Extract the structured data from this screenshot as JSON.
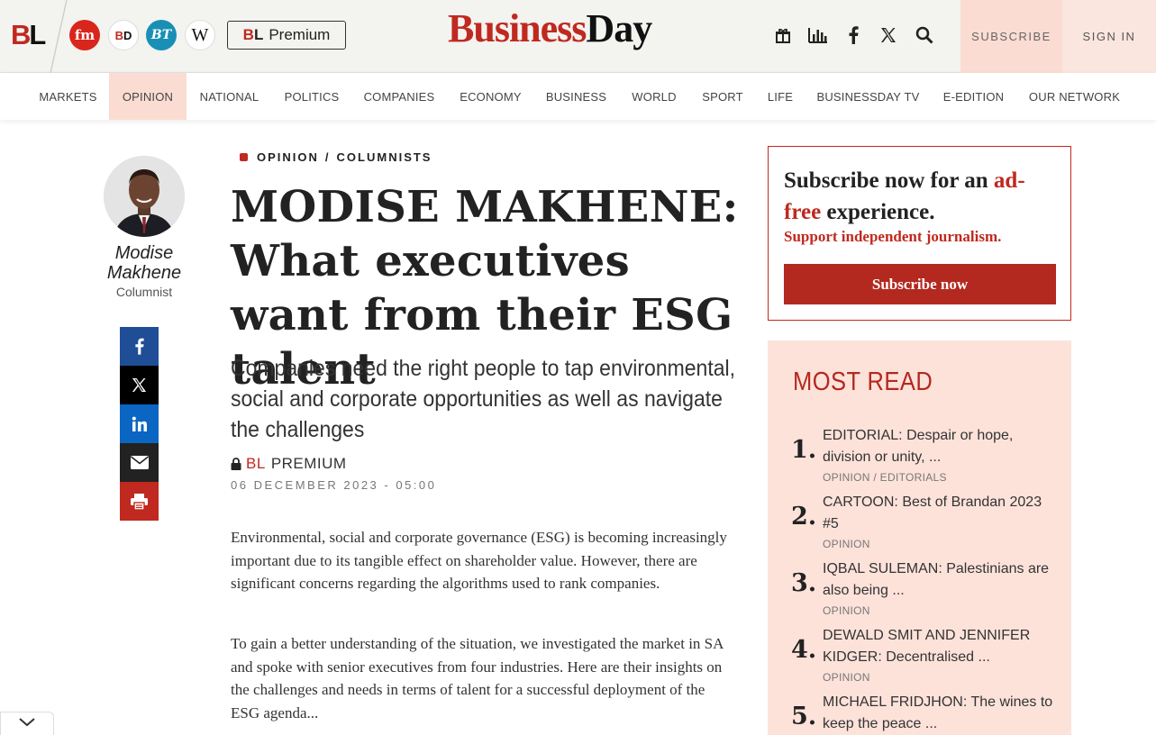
{
  "header": {
    "bl_logo_b": "B",
    "bl_logo_l": "L",
    "brands": {
      "fm": "fm",
      "bd_b": "B",
      "bd_d": "D",
      "bt": "BT",
      "w": "W"
    },
    "premium_b": "B",
    "premium_l": "L",
    "premium_label": "Premium",
    "site_logo_business": "Business",
    "site_logo_day": "Day",
    "icons": [
      "gift-icon",
      "chart-icon",
      "facebook-icon",
      "x-icon",
      "search-icon"
    ],
    "subscribe_label": "SUBSCRIBE",
    "signin_label": "SIGN IN"
  },
  "nav": {
    "items": [
      {
        "label": "MARKETS"
      },
      {
        "label": "OPINION",
        "active": true
      },
      {
        "label": "NATIONAL"
      },
      {
        "label": "POLITICS"
      },
      {
        "label": "COMPANIES"
      },
      {
        "label": "ECONOMY"
      },
      {
        "label": "BUSINESS"
      },
      {
        "label": "WORLD"
      },
      {
        "label": "SPORT"
      },
      {
        "label": "LIFE"
      },
      {
        "label": "BUSINESSDAY TV"
      },
      {
        "label": "E-EDITION"
      },
      {
        "label": "OUR NETWORK"
      }
    ]
  },
  "author": {
    "name_line1": "Modise",
    "name_line2": "Makhene",
    "role": "Columnist"
  },
  "share": {
    "buttons": [
      {
        "name": "facebook-icon",
        "color": "#1f4e96"
      },
      {
        "name": "x-icon",
        "color": "#000000"
      },
      {
        "name": "linkedin-icon",
        "color": "#0a66c2"
      },
      {
        "name": "mail-icon",
        "color": "#222222"
      },
      {
        "name": "print-icon",
        "color": "#c0291f"
      }
    ]
  },
  "article": {
    "section": "OPINION",
    "separator": "/",
    "subsection": "COLUMNISTS",
    "headline": "MODISE MAKHENE: What executives want from their ESG talent",
    "standfirst": "Companies need the right people to tap environmental, social and corporate opportunities as well as navigate the challenges",
    "premium_b": "B",
    "premium_l": "L",
    "premium_label": "PREMIUM",
    "date": "06 DECEMBER 2023 - 05:00",
    "paragraphs": [
      "Environmental, social and corporate governance (ESG) is becoming increasingly important due to its tangible effect on shareholder value. However, there are significant concerns regarding the algorithms used to rank companies.",
      "To gain a better understanding of the situation, we investigated the market in SA and spoke with senior executives from four industries. Here are their insights on the challenges and needs in terms of talent for a successful deployment of the ESG agenda..."
    ]
  },
  "subscribe_box": {
    "title_pre": "Subscribe now for an ",
    "title_red": "ad-free",
    "title_post": " experience.",
    "line": "Support independent journalism.",
    "button": "Subscribe now"
  },
  "most_read": {
    "title": "MOST READ",
    "items": [
      {
        "num": "1.",
        "title": "EDITORIAL: Despair or hope, division or unity, ...",
        "cat": "OPINION / EDITORIALS"
      },
      {
        "num": "2.",
        "title": "CARTOON: Best of Brandan 2023 #5",
        "cat": "OPINION"
      },
      {
        "num": "3.",
        "title": "IQBAL SULEMAN: Palestinians are also being ...",
        "cat": "OPINION"
      },
      {
        "num": "4.",
        "title": "DEWALD SMIT AND JENNIFER KIDGER: Decentralised ...",
        "cat": "OPINION"
      },
      {
        "num": "5.",
        "title": "MICHAEL FRIDJHON: The wines to keep the peace ...",
        "cat": ""
      }
    ]
  },
  "colors": {
    "brand_red": "#c0291f",
    "nav_active_bg": "#fbdcd3",
    "most_read_bg": "#fde2da"
  }
}
